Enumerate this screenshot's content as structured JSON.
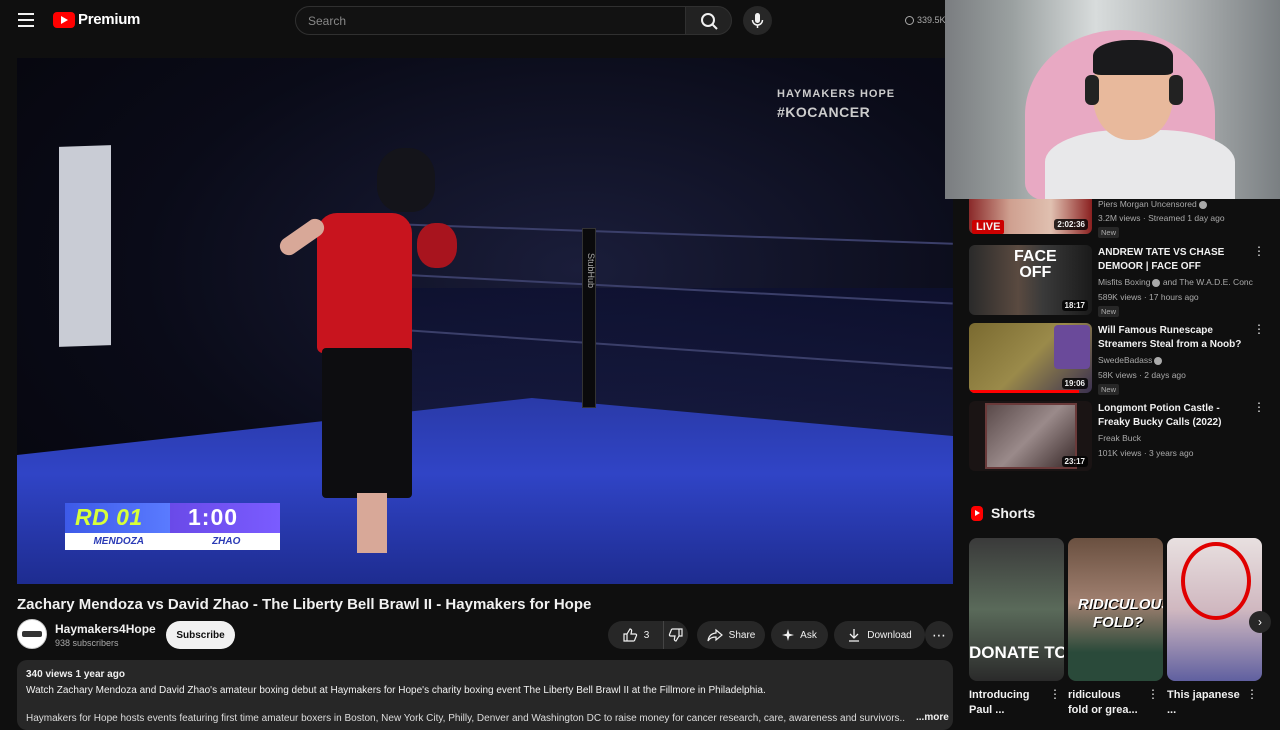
{
  "header": {
    "logo_text": "Premium",
    "search_placeholder": "Search",
    "viewers": "339.5K"
  },
  "player": {
    "overlay_brand_top": "HAYMAKERS HOPE",
    "overlay_brand_bottom": "#KOCANCER",
    "round": "RD 01",
    "time": "1:00",
    "corner_left": "MENDOZA",
    "corner_right": "ZHAO",
    "stubhub": "StubHub"
  },
  "video": {
    "title": "Zachary Mendoza vs David Zhao - The Liberty Bell Brawl II - Haymakers for Hope",
    "channel": "Haymakers4Hope",
    "subscribers": "938 subscribers",
    "subscribe_label": "Subscribe",
    "likes": "3",
    "share_label": "Share",
    "ask_label": "Ask",
    "download_label": "Download"
  },
  "description": {
    "meta": "340 views  1 year ago",
    "line1": "Watch Zachary Mendoza and David Zhao's amateur boxing debut at Haymakers for Hope's charity boxing event The Liberty Bell Brawl II at the Fillmore in Philadelphia.",
    "line2": "Haymakers for Hope hosts events featuring first time amateur boxers in Boston, New York City, Philly, Denver and Washington DC to raise money for cancer research, care, awareness and survivors...",
    "more_label": "...more"
  },
  "sidebar": {
    "items": [
      {
        "title": "",
        "channel": "Piers Morgan Uncensored",
        "meta": "3.2M views · Streamed 1 day ago",
        "badge": "New",
        "duration": "2:02:36",
        "live": "LIVE"
      },
      {
        "title": "ANDREW TATE VS CHASE DEMOOR | FACE OFF",
        "channel": "Misfits Boxing",
        "channel_extra": "and The W.A.D.E. Conc...",
        "meta": "589K views · 17 hours ago",
        "badge": "New",
        "duration": "18:17"
      },
      {
        "title": "Will Famous Runescape Streamers Steal from a Noob?",
        "channel": "SwedeBadass",
        "meta": "58K views · 2 days ago",
        "badge": "New",
        "duration": "19:06"
      },
      {
        "title": "Longmont Potion Castle - Freaky Bucky Calls (2022)",
        "channel": "Freak Buck",
        "meta": "101K views · 3 years ago",
        "duration": "23:17"
      }
    ]
  },
  "shorts": {
    "header": "Shorts",
    "items": [
      {
        "title": "Introducing Paul ...",
        "thumb_text": "DONATE TODAY"
      },
      {
        "title": "ridiculous fold or grea...",
        "thumb_text": "RIDICULOUS FOLD?"
      },
      {
        "title": "This japanese ...",
        "thumb_text": ""
      }
    ]
  },
  "colors": {
    "background": "#0f0f0f",
    "accent_red": "#ff0000",
    "scoreboard_lime": "#d7ff3a",
    "scoreboard_blue": "#3d5ae8"
  }
}
